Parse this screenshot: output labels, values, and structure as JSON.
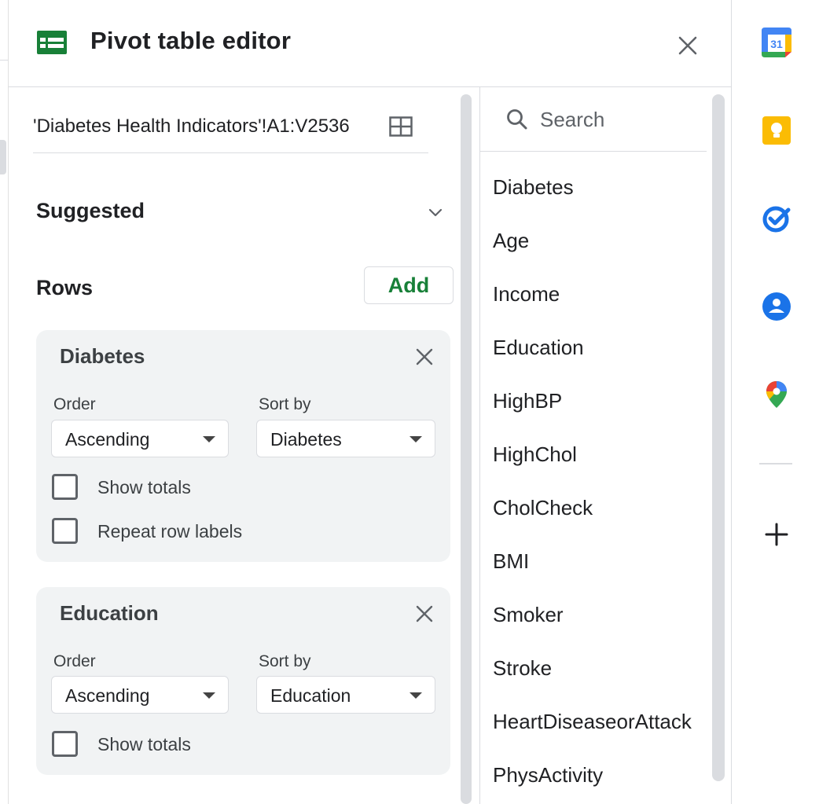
{
  "header": {
    "title": "Pivot table editor"
  },
  "range": {
    "text": "'Diabetes Health Indicators'!A1:V2536"
  },
  "suggested": {
    "label": "Suggested"
  },
  "rows": {
    "label": "Rows",
    "add_label": "Add",
    "cards": [
      {
        "title": "Diabetes",
        "order_label": "Order",
        "order_value": "Ascending",
        "sortby_label": "Sort by",
        "sortby_value": "Diabetes",
        "show_totals": "Show totals",
        "repeat_labels": "Repeat row labels"
      },
      {
        "title": "Education",
        "order_label": "Order",
        "order_value": "Ascending",
        "sortby_label": "Sort by",
        "sortby_value": "Education",
        "show_totals": "Show totals"
      }
    ]
  },
  "search": {
    "placeholder": "Search"
  },
  "fields": [
    "Diabetes",
    "Age",
    "Income",
    "Education",
    "HighBP",
    "HighChol",
    "CholCheck",
    "BMI",
    "Smoker",
    "Stroke",
    "HeartDiseaseorAttack",
    "PhysActivity"
  ],
  "side_apps": {
    "calendar_day": "31",
    "icons": [
      "calendar-icon",
      "keep-icon",
      "tasks-icon",
      "contacts-icon",
      "maps-icon",
      "plus-icon"
    ]
  },
  "colors": {
    "accent_green": "#188038",
    "sheets_green": "#188038",
    "border": "#dadce0",
    "card_bg": "#f1f3f4"
  }
}
